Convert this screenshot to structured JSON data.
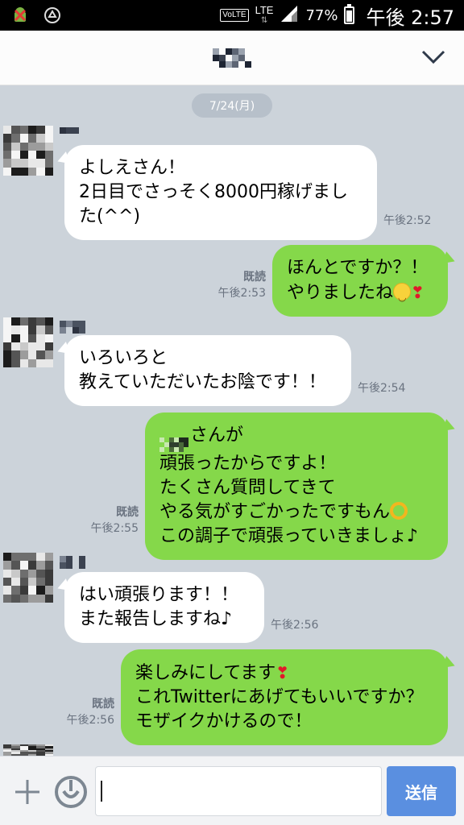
{
  "status_bar": {
    "volte": "VoLTE",
    "lte": "LTE",
    "lte_arrows": "⇅",
    "battery_percent": "77%",
    "battery_level": 0.77,
    "time": "午後 2:57"
  },
  "header": {
    "chevron_icon": "chevron-down-icon"
  },
  "chat": {
    "date": "7/24(月)",
    "messages": [
      {
        "direction": "in",
        "lines": [
          "よしえさん！",
          "2日目でさっそく8000円稼げまし",
          "た(^^)"
        ],
        "time": "午後2:52"
      },
      {
        "direction": "out",
        "lines": [
          "ほんとですか？！",
          "やりましたね"
        ],
        "read": "既読",
        "time": "午後2:53"
      },
      {
        "direction": "in",
        "lines": [
          "いろいろと",
          "教えていただいたお陰です！！"
        ],
        "time": "午後2:54"
      },
      {
        "direction": "out",
        "lines": [
          "さんが",
          "頑張ったからですよ！",
          "たくさん質問してきて",
          "やる気がすごかったですもん",
          "この調子で頑張っていきましょ♪"
        ],
        "read": "既読",
        "time": "午後2:55"
      },
      {
        "direction": "in",
        "lines": [
          "はい頑張ります！！",
          "また報告しますね♪"
        ],
        "time": "午後2:56"
      },
      {
        "direction": "out",
        "lines": [
          "楽しみにしてます",
          "これTwitterにあげてもいいですか？",
          "モザイクかけるので！"
        ],
        "read": "既読",
        "time": "午後2:56"
      }
    ]
  },
  "input_bar": {
    "message_value": "",
    "send_label": "送信"
  },
  "colors": {
    "chat_background": "#ccd3da",
    "outgoing_bubble": "#85d84a",
    "incoming_bubble": "#ffffff",
    "send_button": "#5a8fe0"
  }
}
